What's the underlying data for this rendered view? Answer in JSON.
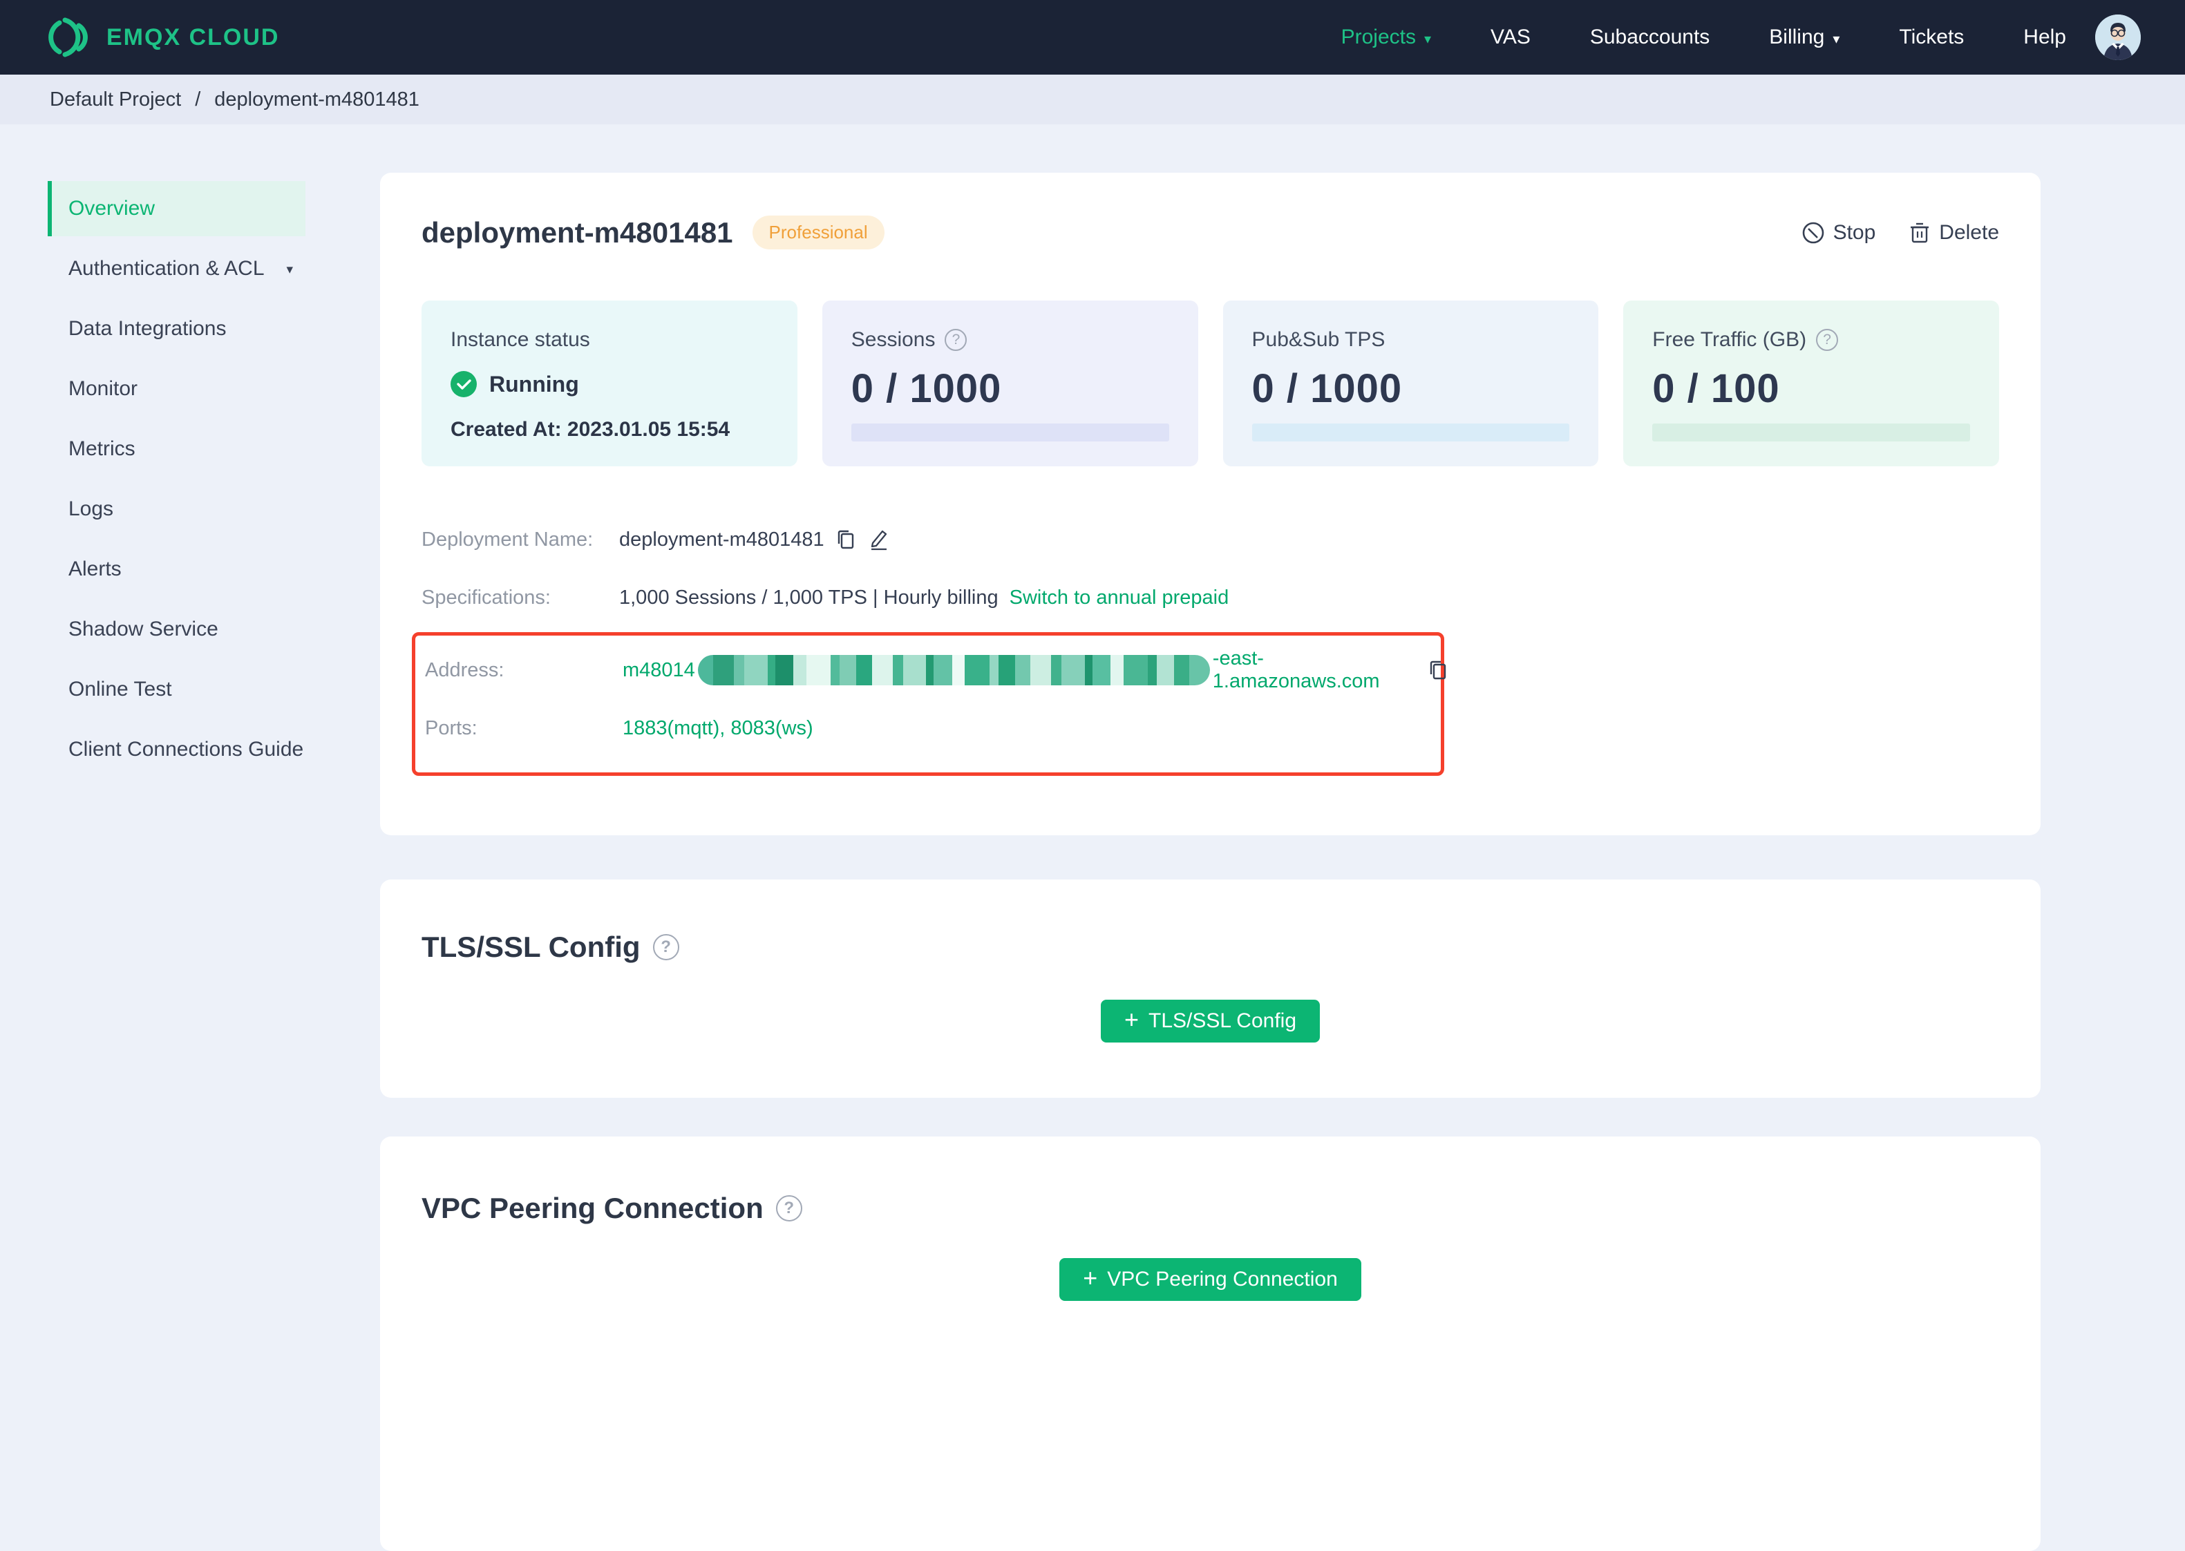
{
  "navbar": {
    "brand": "EMQX CLOUD",
    "items": [
      {
        "label": "Projects"
      },
      {
        "label": "VAS"
      },
      {
        "label": "Subaccounts"
      },
      {
        "label": "Billing"
      },
      {
        "label": "Tickets"
      },
      {
        "label": "Help"
      }
    ]
  },
  "breadcrumb": {
    "project": "Default Project",
    "separator": "/",
    "current": "deployment-m4801481"
  },
  "sidebar": {
    "items": [
      {
        "label": "Overview"
      },
      {
        "label": "Authentication & ACL"
      },
      {
        "label": "Data Integrations"
      },
      {
        "label": "Monitor"
      },
      {
        "label": "Metrics"
      },
      {
        "label": "Logs"
      },
      {
        "label": "Alerts"
      },
      {
        "label": "Shadow Service"
      },
      {
        "label": "Online Test"
      },
      {
        "label": "Client Connections Guide"
      }
    ]
  },
  "overview": {
    "title": "deployment-m4801481",
    "plan_badge": "Professional",
    "actions": {
      "stop": "Stop",
      "delete": "Delete"
    },
    "stats": [
      {
        "label": "Instance status",
        "status": "Running",
        "created": "Created At: 2023.01.05 15:54"
      },
      {
        "label": "Sessions",
        "value": "0 / 1000"
      },
      {
        "label": "Pub&Sub TPS",
        "value": "0 / 1000"
      },
      {
        "label": "Free Traffic (GB)",
        "value": "0 / 100"
      }
    ],
    "details": {
      "deployment_name_label": "Deployment Name:",
      "deployment_name": "deployment-m4801481",
      "specifications_label": "Specifications:",
      "specifications": "1,000 Sessions / 1,000 TPS | Hourly billing",
      "switch_link": "Switch to annual prepaid",
      "address_label": "Address:",
      "address_prefix": "m48014",
      "address_suffix": "-east-1.amazonaws.com",
      "address_mosaic": {
        "colors": [
          "#4db89b",
          "#2fa07c",
          "#6ac3a9",
          "#90d5c0",
          "#35ad85",
          "#1d8f6a",
          "#c3eadd",
          "#e6f8f1",
          "#52bb9b",
          "#7fccb4",
          "#2aa77f",
          "#ddf4ec",
          "#46b592",
          "#a8dfcd",
          "#239a72",
          "#63c2a6",
          "#eefaf6",
          "#39b18a",
          "#95d7c3",
          "#27a278",
          "#73c8ae",
          "#cdeee2",
          "#41b28d",
          "#86d0ba",
          "#1f946e",
          "#58bfa1",
          "#e2f6ef",
          "#4ab794",
          "#2ca37b",
          "#b2e3d3",
          "#3aae87",
          "#68c4a8"
        ]
      },
      "ports_label": "Ports:",
      "ports": "1883(mqtt), 8083(ws)"
    }
  },
  "tls": {
    "title": "TLS/SSL Config",
    "button_label": "TLS/SSL Config"
  },
  "vpc": {
    "title": "VPC Peering Connection",
    "button_label": "VPC Peering Connection"
  },
  "colors": {
    "primary_green": "#0cb573",
    "logo_green": "#1ec287",
    "link_green": "#00a86c",
    "navbar_bg": "#1b2336",
    "page_bg": "#edf1f9",
    "breadcrumb_bg": "#e5e9f4",
    "badge_bg": "#fdf0da",
    "badge_text": "#f0a03a",
    "redaction_box_red": "#f5402c",
    "status_running_green": "#17b26b"
  }
}
